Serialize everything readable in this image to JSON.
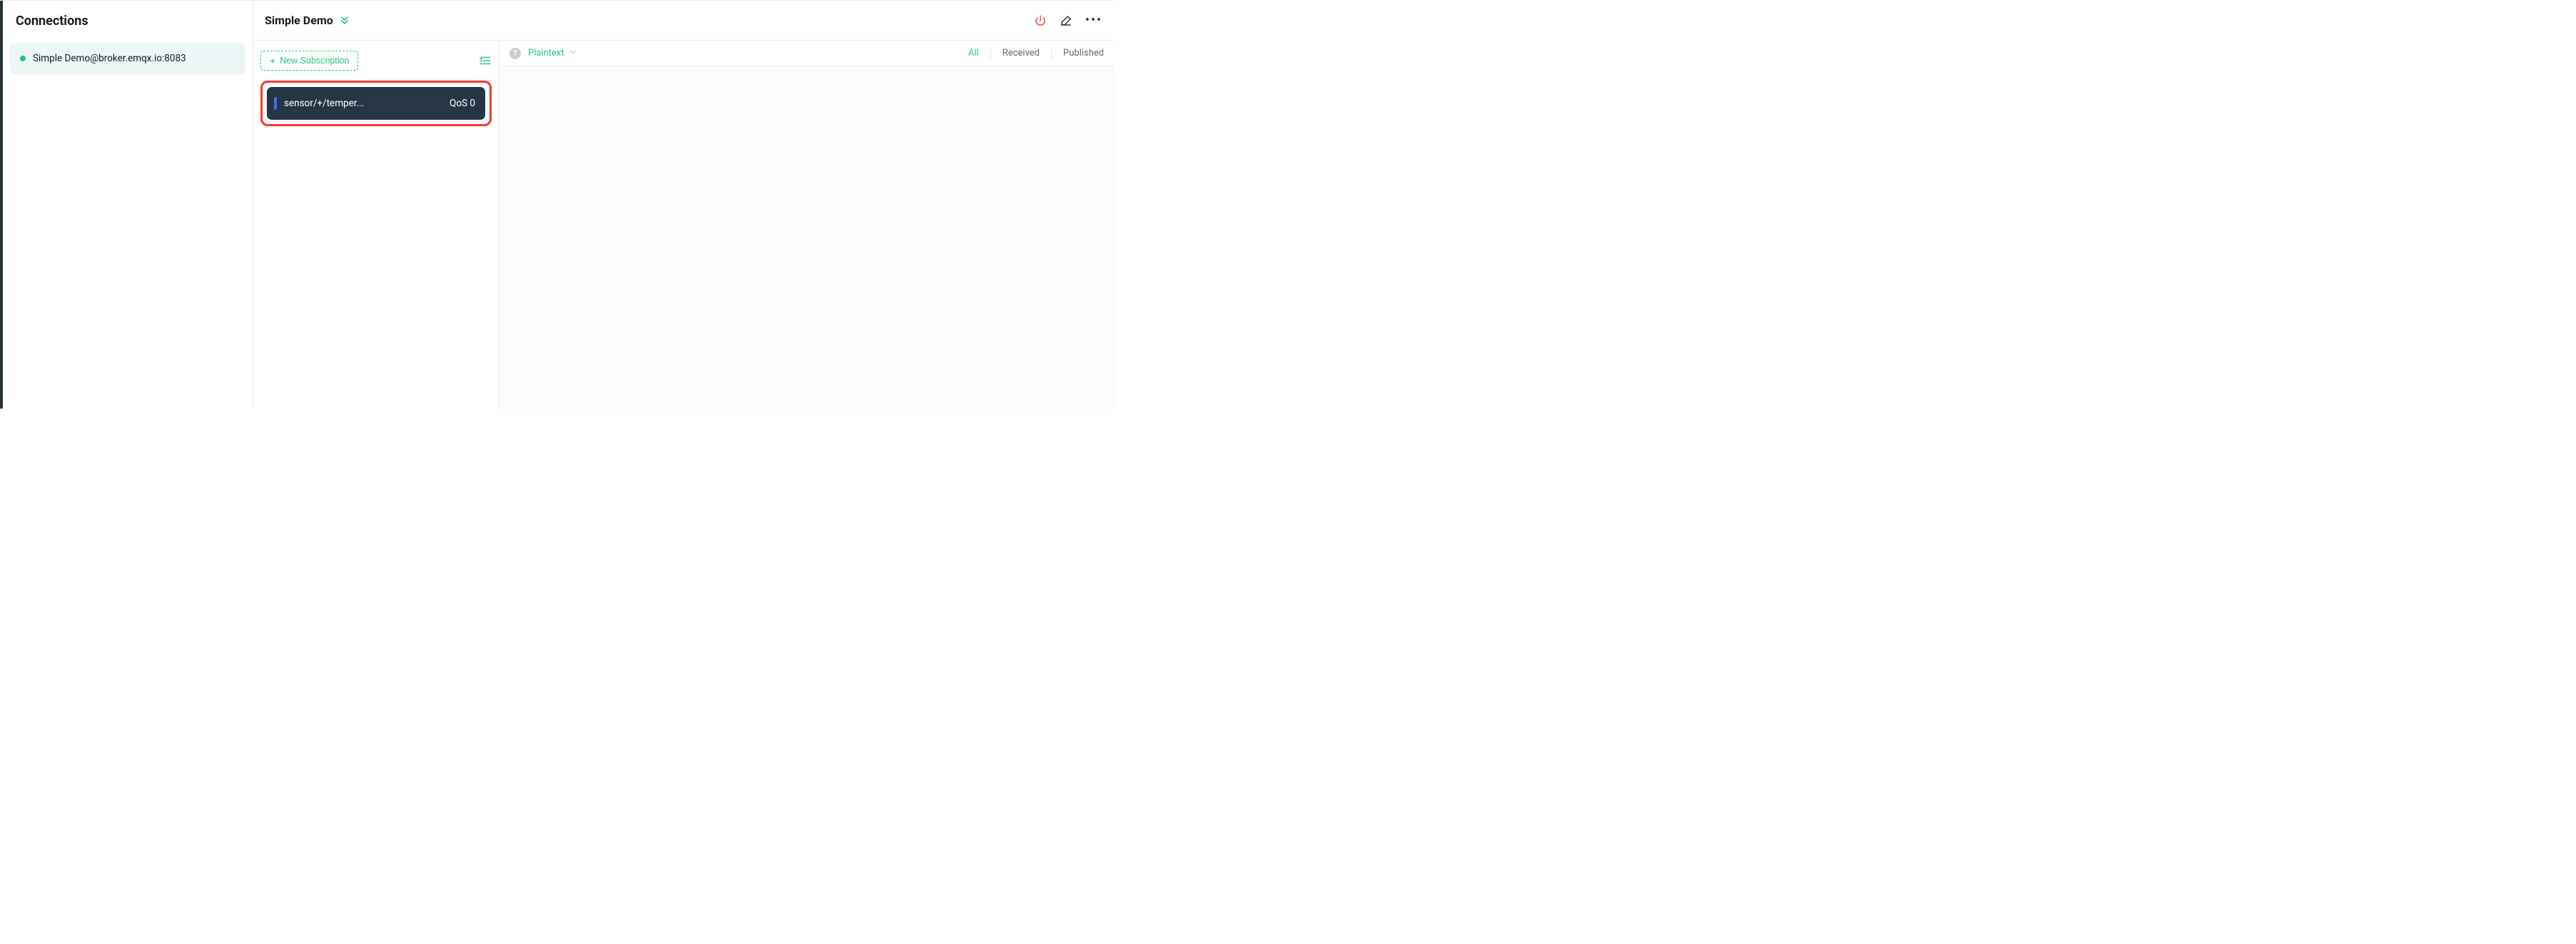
{
  "sidebar": {
    "title": "Connections",
    "items": [
      {
        "label": "Simple Demo@broker.emqx.io:8083",
        "status": "online"
      }
    ]
  },
  "header": {
    "title": "Simple Demo"
  },
  "subscriptions": {
    "new_button_label": "New Subscription",
    "items": [
      {
        "topic": "sensor/+/temper...",
        "qos_label": "QoS 0",
        "stripe_color": "#2a7de1"
      }
    ]
  },
  "messages": {
    "format_label": "Plaintext",
    "filters": {
      "all": "All",
      "received": "Received",
      "published": "Published"
    },
    "active_filter": "all"
  },
  "icons": {
    "help_glyph": "?"
  }
}
